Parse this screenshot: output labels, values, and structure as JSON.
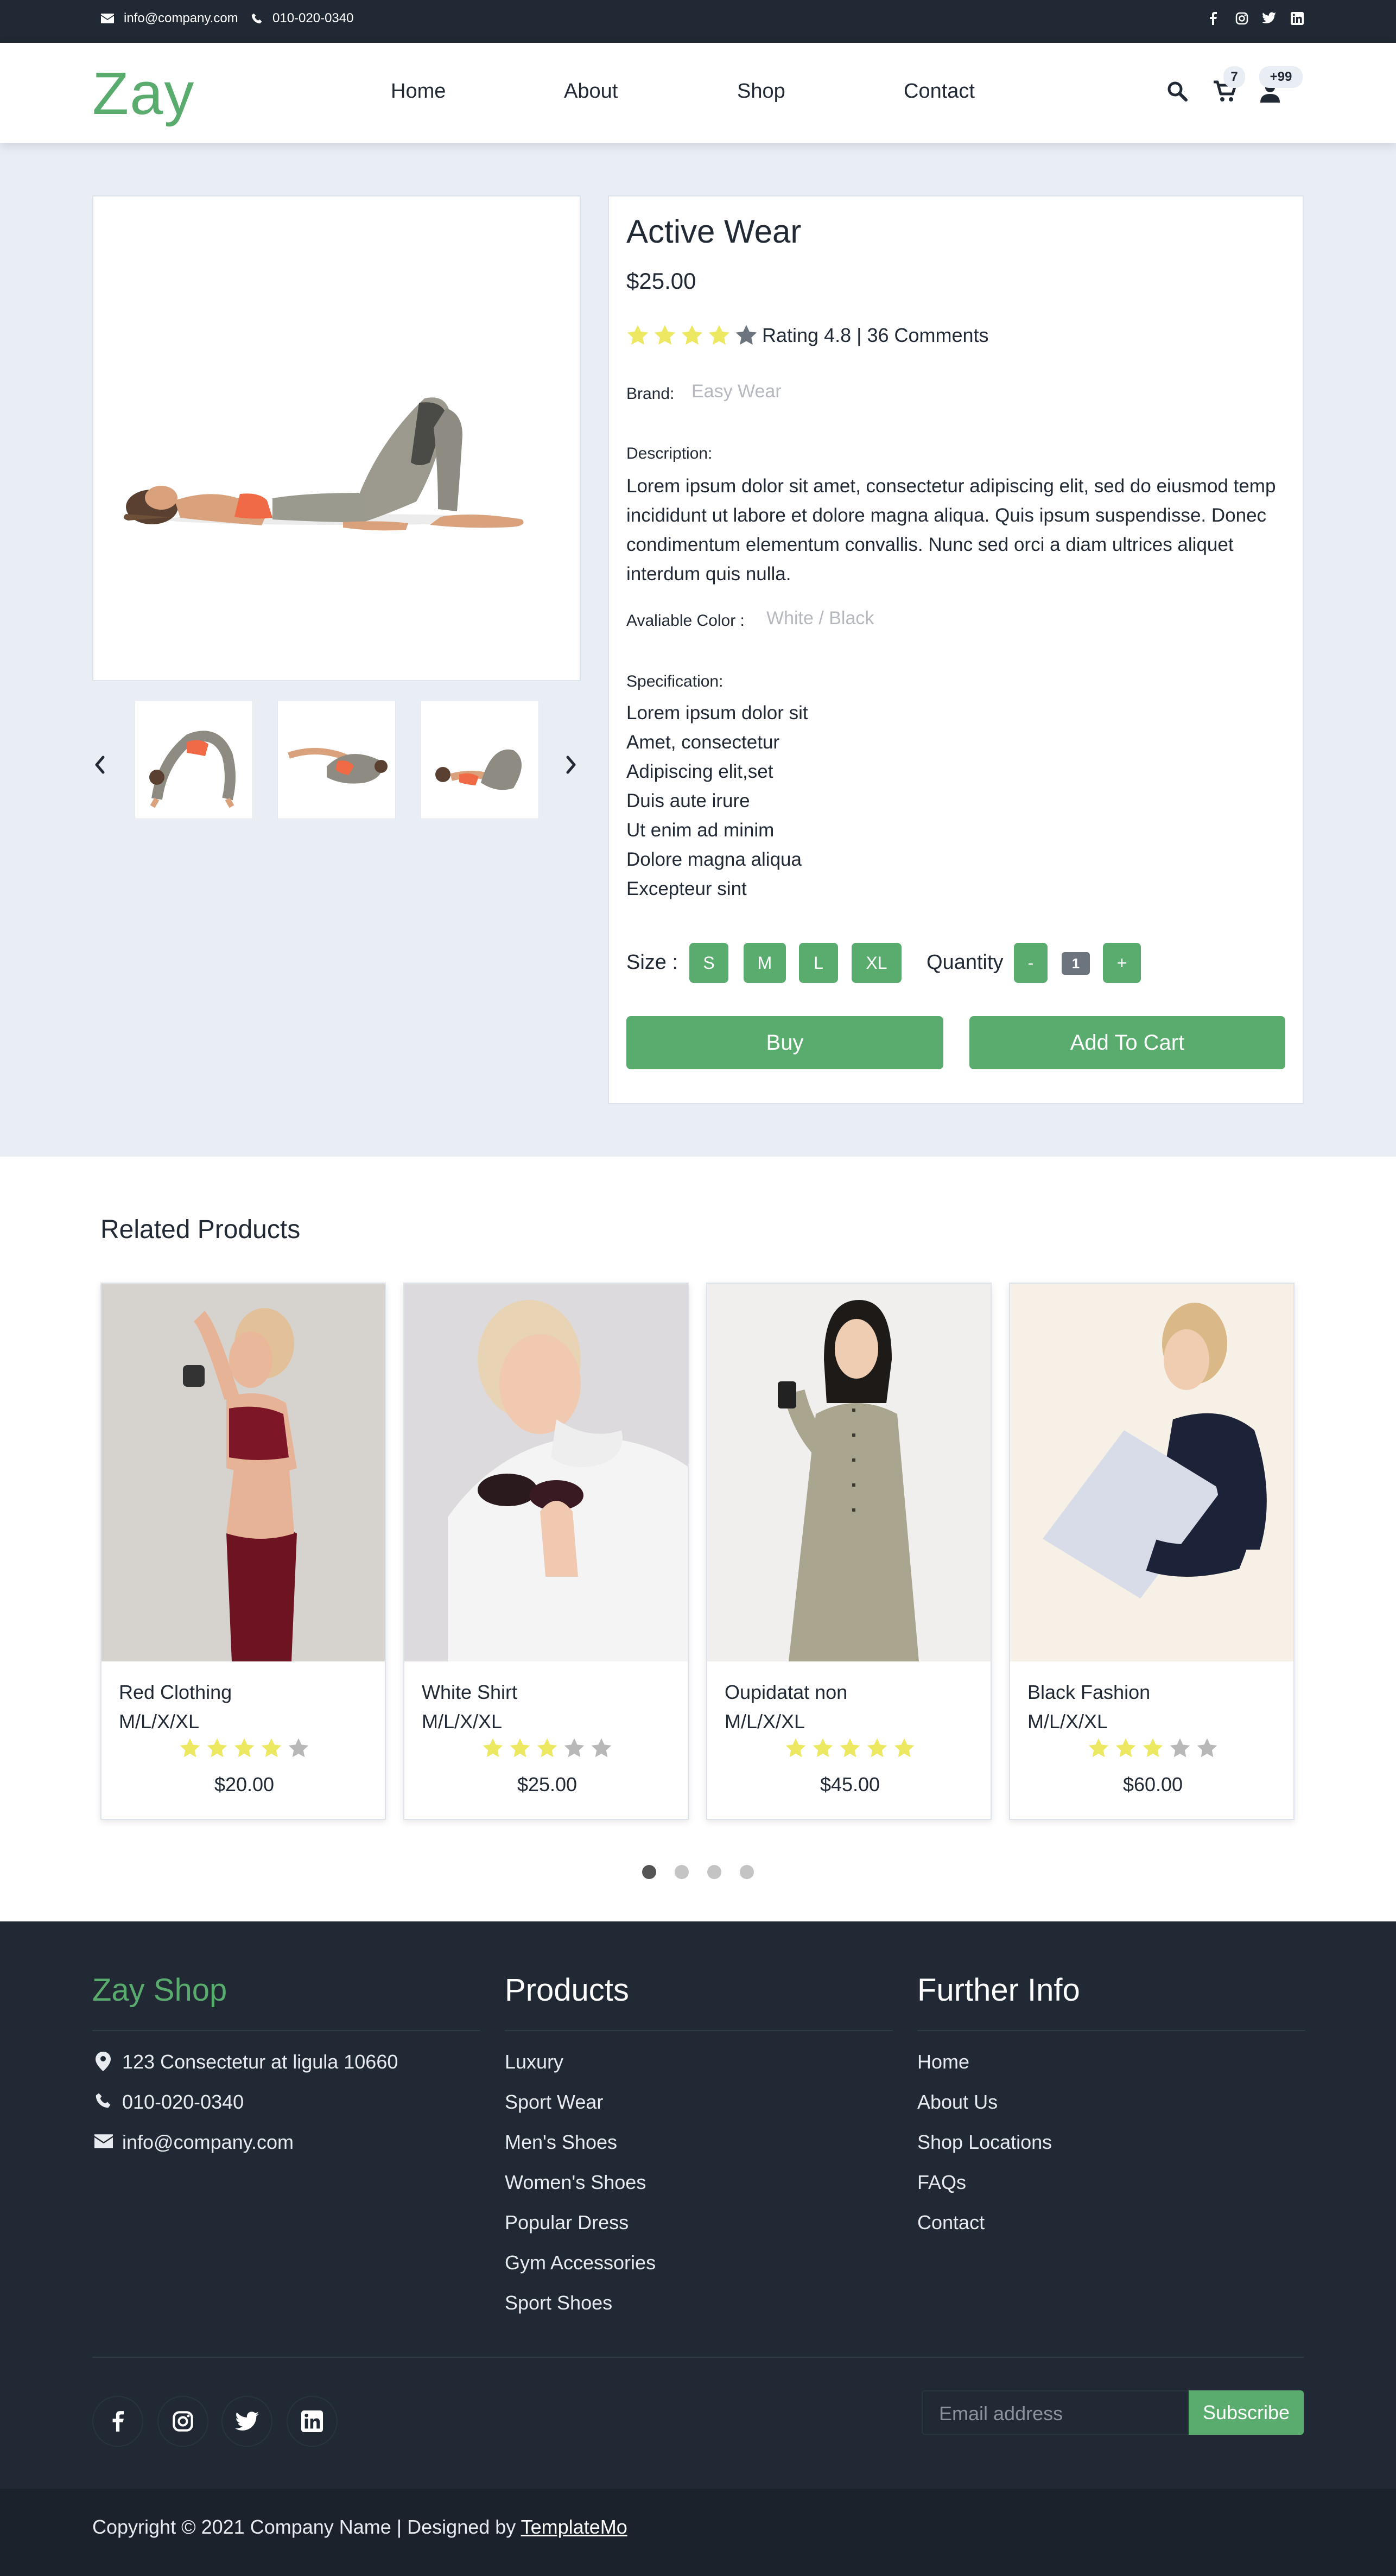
{
  "topbar": {
    "email": "info@company.com",
    "phone": "010-020-0340"
  },
  "header": {
    "logo": "Zay",
    "nav": [
      "Home",
      "About",
      "Shop",
      "Contact"
    ],
    "cart_count": "7",
    "user_count": "+99"
  },
  "product": {
    "title": "Active Wear",
    "price": "$25.00",
    "rating": 4,
    "rating_text": "Rating 4.8 | 36 Comments",
    "brand_label": "Brand:",
    "brand": "Easy Wear",
    "description_label": "Description:",
    "description": "Lorem ipsum dolor sit amet, consectetur adipiscing elit, sed do eiusmod temp incididunt ut labore et dolore magna aliqua. Quis ipsum suspendisse. Donec condimentum elementum convallis. Nunc sed orci a diam ultrices aliquet interdum quis nulla.",
    "color_label": "Avaliable Color :",
    "color": "White / Black",
    "spec_label": "Specification:",
    "specs": [
      "Lorem ipsum dolor sit",
      "Amet, consectetur",
      "Adipiscing elit,set",
      "Duis aute irure",
      "Ut enim ad minim",
      "Dolore magna aliqua",
      "Excepteur sint"
    ],
    "size_label": "Size :",
    "sizes": [
      "S",
      "M",
      "L",
      "XL"
    ],
    "quantity_label": "Quantity",
    "minus": "-",
    "quantity": "1",
    "plus": "+",
    "buy": "Buy",
    "add_to_cart": "Add To Cart"
  },
  "related": {
    "title": "Related Products",
    "items": [
      {
        "name": "Red Clothing",
        "sizes": "M/L/X/XL",
        "rating": 4,
        "price": "$20.00"
      },
      {
        "name": "White Shirt",
        "sizes": "M/L/X/XL",
        "rating": 3,
        "price": "$25.00"
      },
      {
        "name": "Oupidatat non",
        "sizes": "M/L/X/XL",
        "rating": 5,
        "price": "$45.00"
      },
      {
        "name": "Black Fashion",
        "sizes": "M/L/X/XL",
        "rating": 3,
        "price": "$60.00"
      }
    ],
    "active_page": 1
  },
  "footer": {
    "brand": "Zay Shop",
    "address": "123 Consectetur at ligula 10660",
    "phone": "010-020-0340",
    "email": "info@company.com",
    "products_title": "Products",
    "products": [
      "Luxury",
      "Sport Wear",
      "Men's Shoes",
      "Women's Shoes",
      "Popular Dress",
      "Gym Accessories",
      "Sport Shoes"
    ],
    "info_title": "Further Info",
    "info": [
      "Home",
      "About Us",
      "Shop Locations",
      "FAQs",
      "Contact"
    ],
    "email_placeholder": "Email address",
    "subscribe": "Subscribe",
    "copyright": "Copyright © 2021 Company Name | Designed by ",
    "designer": "TemplateMo"
  },
  "colors": {
    "brand_green": "#59ab6e",
    "dark": "#212934",
    "star": "#ede861",
    "star_off": "#6c757d"
  }
}
